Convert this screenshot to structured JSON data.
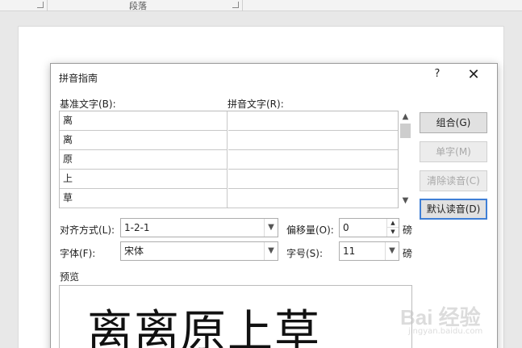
{
  "ribbon": {
    "section_label": "段落"
  },
  "dialog": {
    "title": "拼音指南",
    "help": "?",
    "close": "✕",
    "base_text_label": "基准文字(B):",
    "ruby_text_label": "拼音文字(R):",
    "rows": [
      {
        "base": "离",
        "ruby": ""
      },
      {
        "base": "离",
        "ruby": ""
      },
      {
        "base": "原",
        "ruby": ""
      },
      {
        "base": "上",
        "ruby": ""
      },
      {
        "base": "草",
        "ruby": ""
      }
    ],
    "buttons": {
      "group": "组合(G)",
      "mono": "单字(M)",
      "clear": "清除读音(C)",
      "default_reading": "默认读音(D)"
    },
    "alignment_label": "对齐方式(L):",
    "alignment_value": "1-2-1",
    "offset_label": "偏移量(O):",
    "offset_value": "0",
    "offset_unit": "磅",
    "font_label": "字体(F):",
    "font_value": "宋体",
    "size_label": "字号(S):",
    "size_value": "11",
    "size_unit": "磅",
    "preview_label": "预览",
    "preview_text": "离离原上草"
  },
  "watermark": {
    "text": "Bai 经验",
    "sub": "jingyan.baidu.com"
  }
}
